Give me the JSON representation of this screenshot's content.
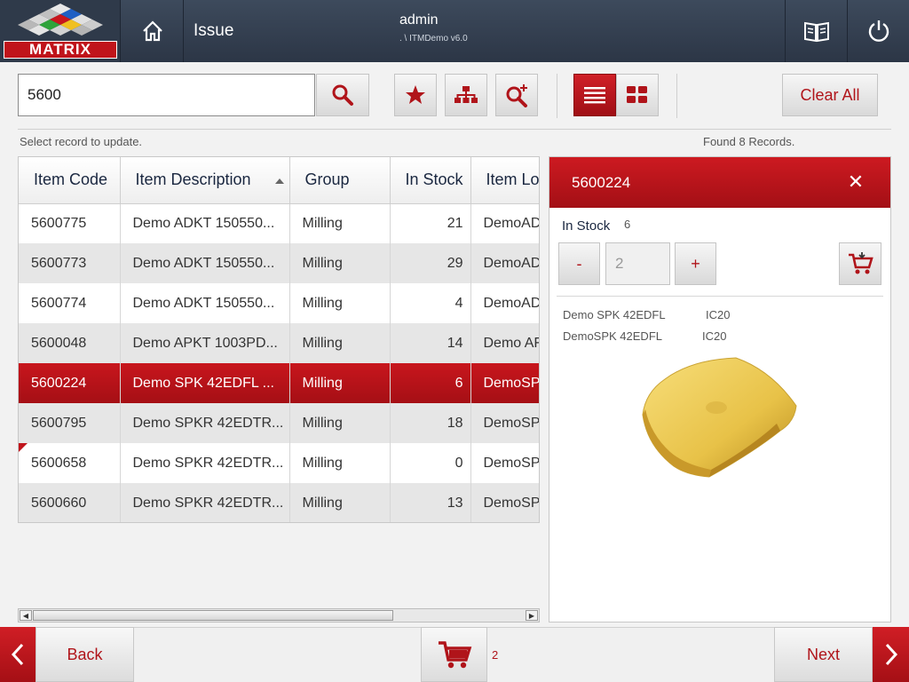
{
  "header": {
    "logo_text": "MATRIX",
    "title": "Issue",
    "user": "admin",
    "version": ". \\ ITMDemo v6.0"
  },
  "toolbar": {
    "search_value": "5600",
    "clear_all_label": "Clear All"
  },
  "status": {
    "hint": "Select record to update.",
    "found": "Found 8 Records."
  },
  "table": {
    "columns": [
      "Item Code",
      "Item Description",
      "Group",
      "In Stock",
      "Item Lon"
    ],
    "rows": [
      {
        "code": "5600775",
        "desc": "Demo ADKT 150550...",
        "group": "Milling",
        "stock": "21",
        "long": "DemoAD"
      },
      {
        "code": "5600773",
        "desc": "Demo ADKT 150550...",
        "group": "Milling",
        "stock": "29",
        "long": "DemoAD"
      },
      {
        "code": "5600774",
        "desc": "Demo ADKT 150550...",
        "group": "Milling",
        "stock": "4",
        "long": "DemoAD"
      },
      {
        "code": "5600048",
        "desc": "Demo APKT 1003PD...",
        "group": "Milling",
        "stock": "14",
        "long": "Demo AF"
      },
      {
        "code": "5600224",
        "desc": "Demo SPK 42EDFL  ...",
        "group": "Milling",
        "stock": "6",
        "long": "DemoSP"
      },
      {
        "code": "5600795",
        "desc": "Demo SPKR 42EDTR...",
        "group": "Milling",
        "stock": "18",
        "long": "DemoSP"
      },
      {
        "code": "5600658",
        "desc": "Demo SPKR 42EDTR...",
        "group": "Milling",
        "stock": "0",
        "long": "DemoSP"
      },
      {
        "code": "5600660",
        "desc": "Demo SPKR 42EDTR...",
        "group": "Milling",
        "stock": "13",
        "long": "DemoSP"
      }
    ],
    "selected_index": 4
  },
  "detail": {
    "title": "5600224",
    "in_stock_label": "In Stock",
    "in_stock_value": "6",
    "minus_label": "-",
    "plus_label": "+",
    "quantity_value": "2",
    "line1_desc": "Demo SPK 42EDFL",
    "line1_code": "IC20",
    "line2_desc": "DemoSPK 42EDFL",
    "line2_code": "IC20"
  },
  "footer": {
    "back_label": "Back",
    "next_label": "Next",
    "cart_count": "2"
  },
  "colors": {
    "accent": "#c0141b",
    "header_bg": "#2f3a4a"
  }
}
